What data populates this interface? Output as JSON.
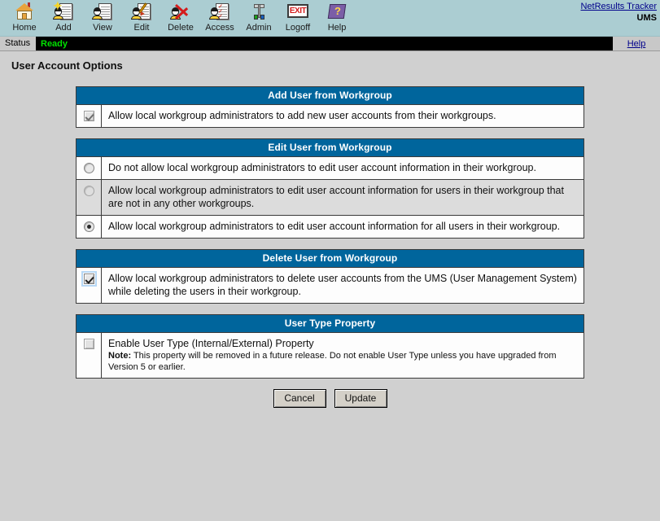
{
  "toolbar": {
    "items": [
      {
        "label": "Home",
        "icon": "home-icon"
      },
      {
        "label": "Add",
        "icon": "add-user-icon"
      },
      {
        "label": "View",
        "icon": "view-user-icon"
      },
      {
        "label": "Edit",
        "icon": "edit-user-icon"
      },
      {
        "label": "Delete",
        "icon": "delete-user-icon"
      },
      {
        "label": "Access",
        "icon": "access-icon"
      },
      {
        "label": "Admin",
        "icon": "admin-icon"
      },
      {
        "label": "Logoff",
        "icon": "exit-icon"
      },
      {
        "label": "Help",
        "icon": "help-book-icon"
      }
    ],
    "brand_link": "NetResults Tracker",
    "brand_sub": "UMS"
  },
  "statusbar": {
    "label": "Status",
    "value": "Ready",
    "help": "Help"
  },
  "page": {
    "title": "User Account Options"
  },
  "sections": [
    {
      "header": "Add User from Workgroup",
      "rows": [
        {
          "control": "checkbox",
          "state": "checked-disabled",
          "text": "Allow local workgroup administrators to add new user accounts from their workgroups."
        }
      ]
    },
    {
      "header": "Edit User from Workgroup",
      "rows": [
        {
          "control": "radio",
          "state": "unselected",
          "text": "Do not allow local workgroup administrators to edit user account information in their workgroup."
        },
        {
          "control": "radio",
          "state": "unselected-dim",
          "text": "Allow local workgroup administrators to edit user account information for users in their workgroup that are not in any other workgroups."
        },
        {
          "control": "radio",
          "state": "selected",
          "text": "Allow local workgroup administrators to edit user account information for all users in their workgroup."
        }
      ]
    },
    {
      "header": "Delete User from Workgroup",
      "rows": [
        {
          "control": "checkbox",
          "state": "checked-focused",
          "text": "Allow local workgroup administrators to delete user accounts from the UMS (User Management System) while deleting the users in their workgroup."
        }
      ]
    },
    {
      "header": "User Type Property",
      "rows": [
        {
          "control": "checkbox",
          "state": "unchecked-disabled",
          "text": "Enable User Type (Internal/External) Property",
          "note_label": "Note:",
          "note_text": " This property will be removed in a future release. Do not enable User Type unless you have upgraded from Version 5 or earlier."
        }
      ]
    }
  ],
  "buttons": {
    "cancel": "Cancel",
    "update": "Update"
  },
  "colors": {
    "toolbar_bg": "#abcdd2",
    "page_bg": "#d0d0d0",
    "section_header_bg": "#00659c",
    "status_bar_bg": "#000000",
    "status_text": "#00e000",
    "link": "#00008b",
    "alt_row_bg": "#dcdcdc"
  }
}
